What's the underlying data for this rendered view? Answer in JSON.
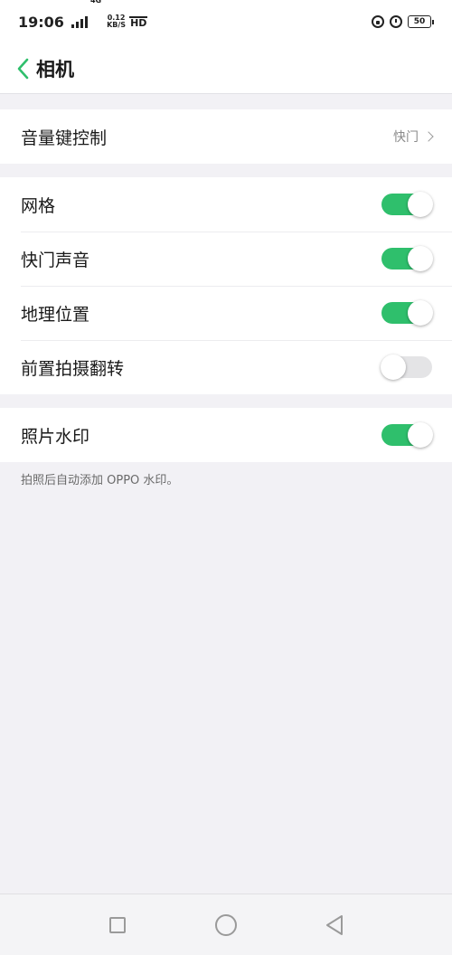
{
  "status_bar": {
    "time": "19:06",
    "network": "4G",
    "speed_value": "0.12",
    "speed_unit": "KB/S",
    "hd": "HD",
    "battery": "50"
  },
  "header": {
    "title": "相机",
    "back_icon": "chevron-left-icon"
  },
  "settings": {
    "volume_key": {
      "label": "音量键控制",
      "value": "快门"
    },
    "grid": {
      "label": "网格",
      "enabled": true
    },
    "shutter_sound": {
      "label": "快门声音",
      "enabled": true
    },
    "location": {
      "label": "地理位置",
      "enabled": true
    },
    "front_mirror": {
      "label": "前置拍摄翻转",
      "enabled": false
    },
    "watermark": {
      "label": "照片水印",
      "enabled": true
    },
    "watermark_note": "拍照后自动添加 OPPO 水印。"
  },
  "nav_bar": {
    "icons": [
      "recent-apps-icon",
      "home-icon",
      "back-icon"
    ]
  },
  "colors": {
    "accent": "#2fbf6c",
    "background": "#f2f1f5",
    "toggle_off": "#e4e4e6"
  }
}
